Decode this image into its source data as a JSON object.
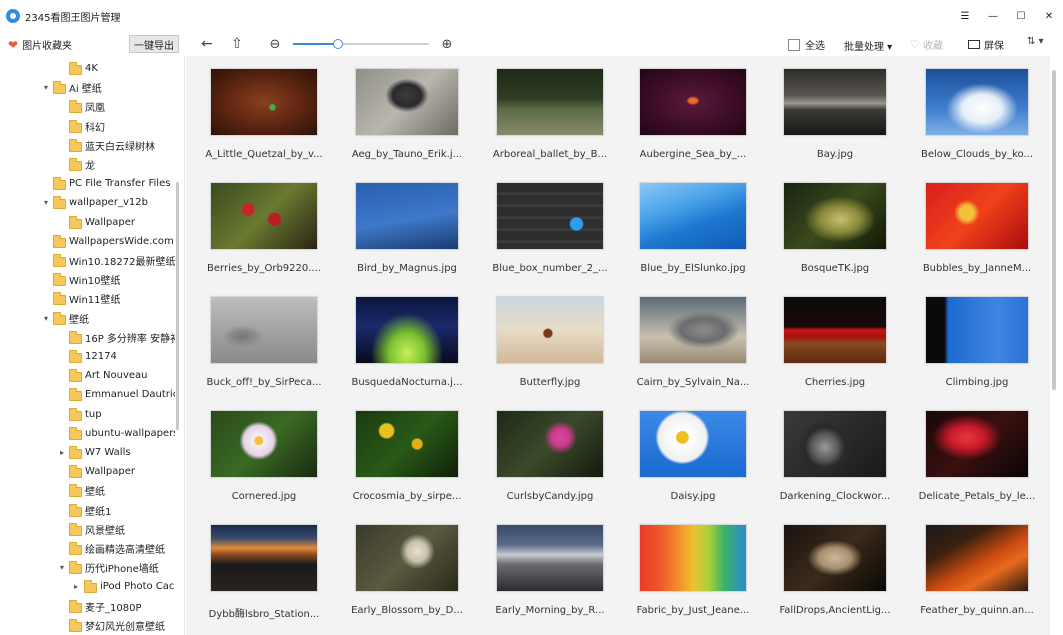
{
  "window": {
    "title": "2345看图王图片管理",
    "menu_glyph": "☰",
    "min_glyph": "—",
    "max_glyph": "☐",
    "close_glyph": "✕"
  },
  "toolbar": {
    "favorites_label": "图片收藏夹",
    "export_label": "一键导出",
    "back_glyph": "←",
    "up_glyph": "⇧",
    "zoom_out_glyph": "⊖",
    "zoom_in_glyph": "⊕",
    "zoom_level": 0.33,
    "select_all_label": "全选",
    "batch_label": "批量处理 ▾",
    "collect_label": "收藏",
    "fullscreen_label": "屏保",
    "sort_glyph": "⇅ ▾"
  },
  "tree": [
    {
      "label": "4K",
      "level": 2,
      "arrow": ""
    },
    {
      "label": "Ai 壁纸",
      "level": 1,
      "arrow": "▾"
    },
    {
      "label": "凤凰",
      "level": 2,
      "arrow": ""
    },
    {
      "label": "科幻",
      "level": 2,
      "arrow": ""
    },
    {
      "label": "蓝天白云绿树林",
      "level": 2,
      "arrow": ""
    },
    {
      "label": "龙",
      "level": 2,
      "arrow": ""
    },
    {
      "label": "PC File Transfer Files",
      "level": 1,
      "arrow": ""
    },
    {
      "label": "wallpaper_v12b",
      "level": 1,
      "arrow": "▾"
    },
    {
      "label": "Wallpaper",
      "level": 2,
      "arrow": ""
    },
    {
      "label": "WallpapersWide.com",
      "level": 1,
      "arrow": ""
    },
    {
      "label": "Win10.18272最新壁纸",
      "level": 1,
      "arrow": ""
    },
    {
      "label": "Win10壁纸",
      "level": 1,
      "arrow": ""
    },
    {
      "label": "Win11壁纸",
      "level": 1,
      "arrow": ""
    },
    {
      "label": "壁纸",
      "level": 1,
      "arrow": "▾"
    },
    {
      "label": "16P 多分辨率 安静补",
      "level": 2,
      "arrow": ""
    },
    {
      "label": "12174",
      "level": 2,
      "arrow": ""
    },
    {
      "label": "Art Nouveau",
      "level": 2,
      "arrow": ""
    },
    {
      "label": "Emmanuel  Dautric",
      "level": 2,
      "arrow": ""
    },
    {
      "label": "tup",
      "level": 2,
      "arrow": ""
    },
    {
      "label": "ubuntu-wallpapers",
      "level": 2,
      "arrow": ""
    },
    {
      "label": "W7 Walls",
      "level": 2,
      "arrow": "▸"
    },
    {
      "label": "Wallpaper",
      "level": 2,
      "arrow": ""
    },
    {
      "label": "壁纸",
      "level": 2,
      "arrow": ""
    },
    {
      "label": "壁纸1",
      "level": 2,
      "arrow": ""
    },
    {
      "label": "风景壁纸",
      "level": 2,
      "arrow": ""
    },
    {
      "label": "绘画精选高清壁纸",
      "level": 2,
      "arrow": ""
    },
    {
      "label": "历代iPhone墙纸",
      "level": 2,
      "arrow": "▾"
    },
    {
      "label": "iPod Photo Cac",
      "level": 3,
      "arrow": "▸"
    },
    {
      "label": "麦子_1080P",
      "level": 2,
      "arrow": ""
    },
    {
      "label": "梦幻风光创意壁纸",
      "level": 2,
      "arrow": ""
    }
  ],
  "images": [
    {
      "caption": "A_Little_Quetzal_by_v...",
      "bg": "radial-gradient(circle at 58% 58%,#3bb03b 0,#3bb03b 4%,transparent 5%),radial-gradient(ellipse at 50% 50%,#8a3f20 0,#5a2410 55%,#2d1208 100%)"
    },
    {
      "caption": "Aeg_by_Tauno_Erik.j...",
      "bg": "radial-gradient(ellipse at 50% 40%,#3d3d3d 0,#2a2a2a 20%,transparent 30%),linear-gradient(135deg,#8f8f88,#b9b6ad 50%,#6d6a62)"
    },
    {
      "caption": "Arboreal_ballet_by_B...",
      "bg": "linear-gradient(180deg,#1e2a18 0,#2f3e24 45%,#5a6a44 60%,#8a8a6a 100%)"
    },
    {
      "caption": "Aubergine_Sea_by_...",
      "bg": "radial-gradient(ellipse at 50% 48%,#f37a3a 0,#e55a20 6%,transparent 9%),radial-gradient(ellipse at 50% 50%,#5a1a3a 0,#3a0c24 60%,#220614 100%)"
    },
    {
      "caption": "Bay.jpg",
      "bg": "linear-gradient(180deg,#2c2c2a 0,#5a5850 40%,#9b978a 52%,#3a3a36 62%,#161614 100%)"
    },
    {
      "caption": "Below_Clouds_by_ko...",
      "bg": "radial-gradient(ellipse at 55% 60%,#ffffff 0,#e6eef8 25%,transparent 45%),linear-gradient(180deg,#1b4f9c,#3f7fcf 60%,#7fb0e6)"
    },
    {
      "caption": "Berries_by_Orb9220....",
      "bg": "radial-gradient(circle at 35% 40%,#c4242a 0,#c4242a 7%,transparent 9%),radial-gradient(circle at 60% 55%,#b81e26 0,#b81e26 8%,transparent 10%),linear-gradient(135deg,#3a4a20,#6b7a30 50%,#2a2414)"
    },
    {
      "caption": "Bird_by_Magnus.jpg",
      "bg": "linear-gradient(170deg,#2a5fb0 0,#3e78c8 55%,#1a3b70 100%)"
    },
    {
      "caption": "Blue_box_number_2_...",
      "bg": "radial-gradient(circle at 75% 62%,#2a9ef0 0,#2a9ef0 7%,transparent 8%),repeating-linear-gradient(180deg,#2e2e2e 0,#2e2e2e 9px,#3d3d3d 10px,#3d3d3d 12px)"
    },
    {
      "caption": "Blue_by_ElSlunko.jpg",
      "bg": "linear-gradient(160deg,#8cc8f5 0,#4aa3ea 35%,#1f78d0 60%,#0f5ab8 100%)"
    },
    {
      "caption": "BosqueTK.jpg",
      "bg": "radial-gradient(ellipse at 55% 55%,#c8c070 0,#8a8a3a 25%,transparent 45%),linear-gradient(135deg,#1a2410,#3a4a1c 50%,#121808)"
    },
    {
      "caption": "Bubbles_by_JanneM...",
      "bg": "radial-gradient(circle at 40% 45%,#f3c03a 0,#f3c03a 10%,transparent 18%),linear-gradient(135deg,#d81e1e,#f0421a 50%,#a80c0c)"
    },
    {
      "caption": "Buck_off!_by_SirPeca...",
      "bg": "radial-gradient(ellipse at 30% 60%,#777 0,#888 10%,transparent 20%),linear-gradient(180deg,#bdbdbd,#9e9e9e 60%,#8a8a8a)"
    },
    {
      "caption": "BusquedaNocturna.j...",
      "bg": "radial-gradient(ellipse at 50% 85%,#c8f05a 0,#7ac030 25%,transparent 50%),linear-gradient(180deg,#0c1640,#1a2a6a 45%,#0a0a1e)"
    },
    {
      "caption": "Butterfly.jpg",
      "bg": "radial-gradient(circle at 48% 55%,#7a3a1a 0,#7a3a1a 6%,transparent 8%),linear-gradient(180deg,#c8d6e0,#e8dcc6 50%,#d0b898)"
    },
    {
      "caption": "Cairn_by_Sylvain_Na...",
      "bg": "radial-gradient(ellipse at 60% 50%,#8a8c8e 0,#6a6c6e 25%,transparent 40%),linear-gradient(180deg,#5a6a78,#c8c0b0 60%,#9a8a74)"
    },
    {
      "caption": "Cherries.jpg",
      "bg": "linear-gradient(180deg,#0a0a0a 0,#1a0a08 45%,#c81818 50%,#a81010 60%,#8a4a20 70%,#5a2a10 100%)"
    },
    {
      "caption": "Climbing.jpg",
      "bg": "linear-gradient(90deg,#0a0a0a 0,#0a0a0a 18%,#1e6ad0 22%,#3f85e0 70%,#2a72d8 100%)"
    },
    {
      "caption": "Cornered.jpg",
      "bg": "radial-gradient(circle at 45% 45%,#f4c040 0,#f4c040 6%,#f2f0f4 7%,#e8d0e8 22%,transparent 28%),linear-gradient(135deg,#2a4a1a,#3a6a24 50%,#1a2a10)"
    },
    {
      "caption": "Crocosmia_by_sirpe...",
      "bg": "radial-gradient(circle at 30% 30%,#e8c020 0,#e8c020 8%,transparent 10%),radial-gradient(circle at 60% 50%,#e0b018 0,#e0b018 7%,transparent 9%),linear-gradient(135deg,#1a3a10,#2a5a18 50%,#0e2008)"
    },
    {
      "caption": "CurlsbyCandy.jpg",
      "bg": "radial-gradient(circle at 60% 40%,#d84a9a 0,#c83a8a 12%,transparent 22%),linear-gradient(135deg,#1e2a18,#3a4a2a 50%,#141a10)"
    },
    {
      "caption": "Daisy.jpg",
      "bg": "radial-gradient(circle at 40% 40%,#f0c020 0,#f0c020 8%,#ffffff 9%,#f0f0f0 32%,transparent 36%),linear-gradient(180deg,#3a8ae8,#1a6ad0)"
    },
    {
      "caption": "Darkening_Clockwor...",
      "bg": "radial-gradient(circle at 40% 55%,#9a9a9a 0,#5a5a5a 18%,#2a2a2a 28%,transparent 38%),linear-gradient(135deg,#3a3a3a,#1a1a1a)"
    },
    {
      "caption": "Delicate_Petals_by_le...",
      "bg": "radial-gradient(ellipse at 40% 40%,#e83a3a 0,#c81a2a 20%,transparent 40%),linear-gradient(135deg,#1a0808,#3a1010 50%,#0a0404)"
    },
    {
      "caption": "Dybb酶lsbro_Station...",
      "bg": "linear-gradient(180deg,#1a2a4a 0,#3a4a6a 20%,#e08a3a 35%,#8a4a20 45%,#1a1a1a 60%,#2a2420 100%)"
    },
    {
      "caption": "Early_Blossom_by_D...",
      "bg": "radial-gradient(circle at 60% 40%,#e8e0d0 0,#c8c0a8 14%,transparent 24%),linear-gradient(135deg,#3a3a2a,#5a5a40 50%,#2a2a1a)"
    },
    {
      "caption": "Early_Morning_by_R...",
      "bg": "linear-gradient(180deg,#3a4a6a 0,#5a6a88 30%,#c8ccd4 45%,#6a6a70 60%,#2a2a30 100%)"
    },
    {
      "caption": "Fabric_by_Just_Jeane...",
      "bg": "linear-gradient(90deg,#e83a2a 0,#f05a2a 20%,#f08a2a 35%,#f0c030 50%,#a8d03a 65%,#3ab06a 80%,#2a8ad0 100%)"
    },
    {
      "caption": "FallDrops,AncientLig...",
      "bg": "radial-gradient(ellipse at 50% 50%,#c8b89a 0,#a89070 22%,transparent 38%),linear-gradient(135deg,#1a1410,#3a2a1a 50%,#0a0806)"
    },
    {
      "caption": "Feather_by_quinn.an...",
      "bg": "linear-gradient(150deg,#1a1a1a 0,#3a2010 30%,#c84a10 55%,#e86a20 70%,#2a1a10 100%)"
    }
  ]
}
